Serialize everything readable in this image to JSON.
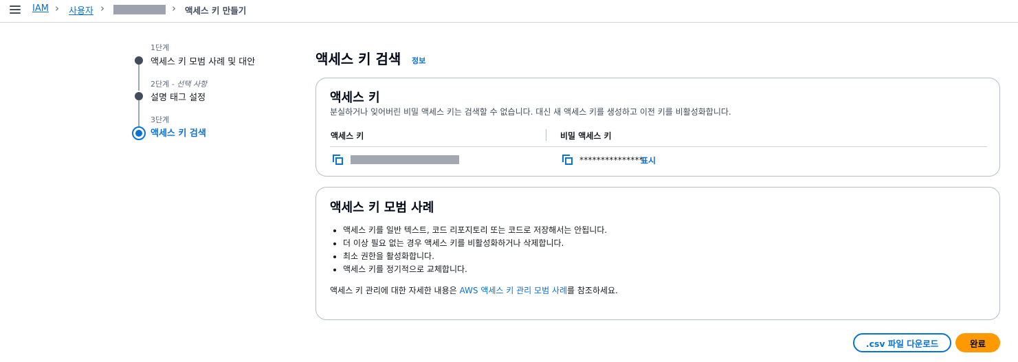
{
  "breadcrumb": {
    "items": [
      {
        "label": "IAM"
      },
      {
        "label": "사용자"
      },
      {
        "label": ""
      },
      {
        "label": "액세스 키 만들기"
      }
    ]
  },
  "steps": [
    {
      "number": "1단계",
      "optional": "",
      "title": "액세스 키 모범 사례 및 대안"
    },
    {
      "number": "2단계 - ",
      "optional": "선택 사항",
      "title": "설명 태그 설정"
    },
    {
      "number": "3단계",
      "optional": "",
      "title": "액세스 키 검색"
    }
  ],
  "page": {
    "title": "액세스 키 검색",
    "info_link": "정보"
  },
  "access_key_card": {
    "heading": "액세스 키",
    "description": "분실하거나 잊어버린 비밀 액세스 키는 검색할 수 없습니다. 대신 새 액세스 키를 생성하고 이전 키를 비활성화합니다.",
    "col_access_key": "액세스 키",
    "col_secret_key": "비밀 액세스 키",
    "secret_masked": "***************",
    "show_label": "표시"
  },
  "best_practice_card": {
    "heading": "액세스 키 모범 사례",
    "bullets": [
      "액세스 키를 일반 텍스트, 코드 리포지토리 또는 코드로 저장해서는 안됩니다.",
      "더 이상 필요 없는 경우 액세스 키를 비활성화하거나 삭제합니다.",
      "최소 권한을 활성화합니다.",
      "액세스 키를 정기적으로 교체합니다."
    ],
    "para_before": "액세스 키 관리에 대한 자세한 내용은 ",
    "para_link": "AWS 액세스 키 관리 모범 사례",
    "para_after": "를 참조하세요."
  },
  "buttons": {
    "download_csv": ".csv 파일 다운로드",
    "done": "완료"
  },
  "colors": {
    "link": "#0972d3",
    "primary_button": "#ff9900",
    "text": "#16191f"
  },
  "icons": [
    "menu-icon",
    "chevron-right-icon",
    "copy-icon"
  ]
}
